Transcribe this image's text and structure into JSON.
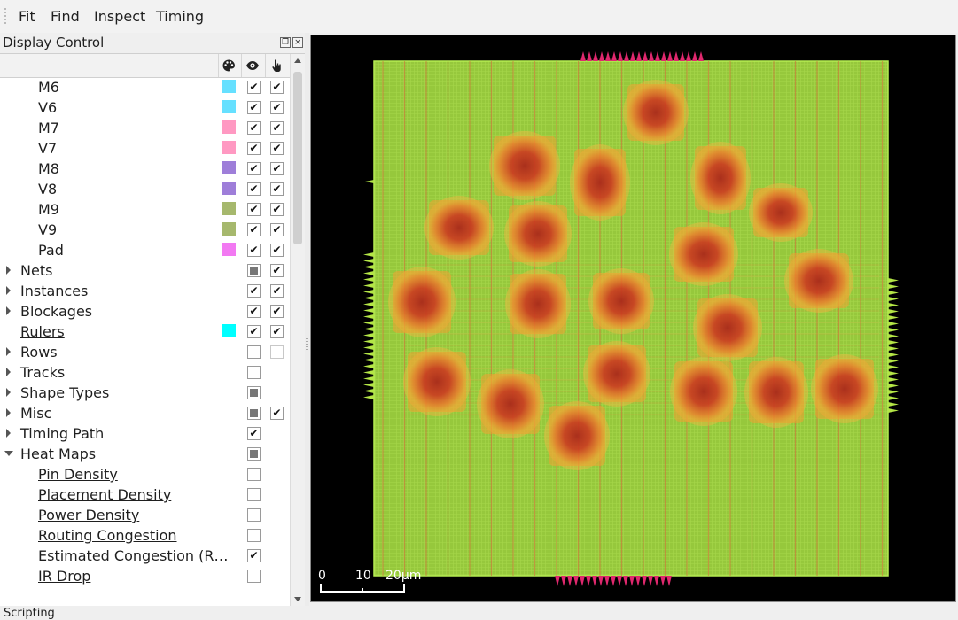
{
  "menu": [
    "Fit",
    "Find",
    "Inspect",
    "Timing"
  ],
  "dock": {
    "title": "Display Control"
  },
  "header_icons": [
    "palette-icon",
    "eye-icon",
    "pointer-hand-icon"
  ],
  "rows": [
    {
      "label": "M6",
      "indent": 1,
      "color": "#66e0ff",
      "visible": "checked",
      "selectable": "checked"
    },
    {
      "label": "V6",
      "indent": 1,
      "color": "#66e0ff",
      "visible": "checked",
      "selectable": "checked"
    },
    {
      "label": "M7",
      "indent": 1,
      "color": "#ff99c2",
      "visible": "checked",
      "selectable": "checked"
    },
    {
      "label": "V7",
      "indent": 1,
      "color": "#ff99c2",
      "visible": "checked",
      "selectable": "checked"
    },
    {
      "label": "M8",
      "indent": 1,
      "color": "#9e7ed9",
      "visible": "checked",
      "selectable": "checked"
    },
    {
      "label": "V8",
      "indent": 1,
      "color": "#9e7ed9",
      "visible": "checked",
      "selectable": "checked"
    },
    {
      "label": "M9",
      "indent": 1,
      "color": "#a6b86d",
      "visible": "checked",
      "selectable": "checked"
    },
    {
      "label": "V9",
      "indent": 1,
      "color": "#a6b86d",
      "visible": "checked",
      "selectable": "checked"
    },
    {
      "label": "Pad",
      "indent": 1,
      "color": "#f279f2",
      "visible": "checked",
      "selectable": "checked"
    },
    {
      "label": "Nets",
      "indent": 0,
      "expander": "right",
      "visible": "partial",
      "selectable": "checked"
    },
    {
      "label": "Instances",
      "indent": 0,
      "expander": "right",
      "visible": "checked",
      "selectable": "checked"
    },
    {
      "label": "Blockages",
      "indent": 0,
      "expander": "right",
      "visible": "checked",
      "selectable": "checked"
    },
    {
      "label": "Rulers",
      "indent": 0,
      "underline": true,
      "color": "#00ffff",
      "visible": "checked",
      "selectable": "checked"
    },
    {
      "label": "Rows",
      "indent": 0,
      "expander": "right",
      "visible": "unchecked",
      "selectable": "disabled"
    },
    {
      "label": "Tracks",
      "indent": 0,
      "expander": "right",
      "visible": "unchecked"
    },
    {
      "label": "Shape Types",
      "indent": 0,
      "expander": "right",
      "visible": "partial"
    },
    {
      "label": "Misc",
      "indent": 0,
      "expander": "right",
      "visible": "partial",
      "selectable": "checked"
    },
    {
      "label": "Timing Path",
      "indent": 0,
      "expander": "right",
      "visible": "checked"
    },
    {
      "label": "Heat Maps",
      "indent": 0,
      "expander": "down",
      "visible": "partial"
    },
    {
      "label": "Pin Density",
      "indent": 1,
      "underline": true,
      "visible": "unchecked"
    },
    {
      "label": "Placement Density",
      "indent": 1,
      "underline": true,
      "visible": "unchecked"
    },
    {
      "label": "Power Density",
      "indent": 1,
      "underline": true,
      "visible": "unchecked"
    },
    {
      "label": "Routing Congestion",
      "indent": 1,
      "underline": true,
      "visible": "unchecked"
    },
    {
      "label": "Estimated Congestion (R…",
      "indent": 1,
      "underline": true,
      "visible": "checked"
    },
    {
      "label": "IR Drop",
      "indent": 1,
      "underline": true,
      "visible": "unchecked"
    }
  ],
  "scale_bar": {
    "labels": [
      "0",
      "10",
      "20μm"
    ]
  },
  "status": {
    "text": "Scripting"
  },
  "colors": {
    "die": "#96c83c",
    "grid": "#a6d84a",
    "hotspot": "#c8321e",
    "pad_magenta": "#e0286e",
    "pad_green": "#b4e646"
  }
}
